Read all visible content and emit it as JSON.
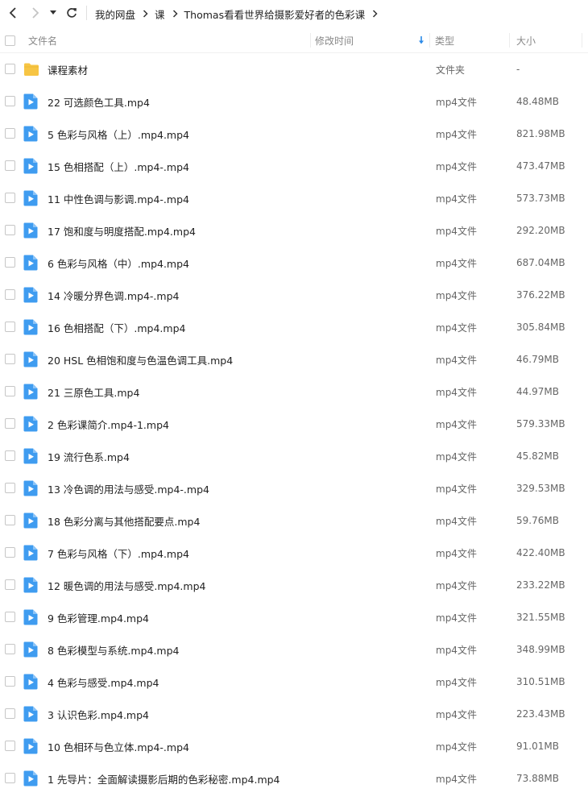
{
  "breadcrumb": [
    "我的网盘",
    "课",
    "Thomas看看世界给摄影爱好者的色彩课"
  ],
  "columns": {
    "name": "文件名",
    "modified": "修改时间",
    "type": "类型",
    "size": "大小"
  },
  "colors": {
    "accent": "#2b8ae8",
    "folder": "#f7c544",
    "video": "#3f9cf0"
  },
  "rows": [
    {
      "name": "课程素材",
      "type": "文件夹",
      "size": "-",
      "icon": "folder-icon"
    },
    {
      "name": "22 可选颜色工具.mp4",
      "type": "mp4文件",
      "size": "48.48MB",
      "icon": "video-file-icon"
    },
    {
      "name": "5 色彩与风格（上）.mp4.mp4",
      "type": "mp4文件",
      "size": "821.98MB",
      "icon": "video-file-icon"
    },
    {
      "name": "15 色相搭配（上）.mp4-.mp4",
      "type": "mp4文件",
      "size": "473.47MB",
      "icon": "video-file-icon"
    },
    {
      "name": "11 中性色调与影调.mp4-.mp4",
      "type": "mp4文件",
      "size": "573.73MB",
      "icon": "video-file-icon"
    },
    {
      "name": "17 饱和度与明度搭配.mp4.mp4",
      "type": "mp4文件",
      "size": "292.20MB",
      "icon": "video-file-icon"
    },
    {
      "name": "6 色彩与风格（中）.mp4.mp4",
      "type": "mp4文件",
      "size": "687.04MB",
      "icon": "video-file-icon"
    },
    {
      "name": "14 冷暖分界色调.mp4-.mp4",
      "type": "mp4文件",
      "size": "376.22MB",
      "icon": "video-file-icon"
    },
    {
      "name": "16 色相搭配（下）.mp4.mp4",
      "type": "mp4文件",
      "size": "305.84MB",
      "icon": "video-file-icon"
    },
    {
      "name": "20 HSL 色相饱和度与色温色调工具.mp4",
      "type": "mp4文件",
      "size": "46.79MB",
      "icon": "video-file-icon"
    },
    {
      "name": "21 三原色工具.mp4",
      "type": "mp4文件",
      "size": "44.97MB",
      "icon": "video-file-icon"
    },
    {
      "name": "2 色彩课简介.mp4-1.mp4",
      "type": "mp4文件",
      "size": "579.33MB",
      "icon": "video-file-icon"
    },
    {
      "name": "19 流行色系.mp4",
      "type": "mp4文件",
      "size": "45.82MB",
      "icon": "video-file-icon"
    },
    {
      "name": "13 冷色调的用法与感受.mp4-.mp4",
      "type": "mp4文件",
      "size": "329.53MB",
      "icon": "video-file-icon"
    },
    {
      "name": "18 色彩分离与其他搭配要点.mp4",
      "type": "mp4文件",
      "size": "59.76MB",
      "icon": "video-file-icon"
    },
    {
      "name": "7 色彩与风格（下）.mp4.mp4",
      "type": "mp4文件",
      "size": "422.40MB",
      "icon": "video-file-icon"
    },
    {
      "name": "12 暖色调的用法与感受.mp4.mp4",
      "type": "mp4文件",
      "size": "233.22MB",
      "icon": "video-file-icon"
    },
    {
      "name": "9 色彩管理.mp4.mp4",
      "type": "mp4文件",
      "size": "321.55MB",
      "icon": "video-file-icon"
    },
    {
      "name": "8 色彩模型与系统.mp4.mp4",
      "type": "mp4文件",
      "size": "348.99MB",
      "icon": "video-file-icon"
    },
    {
      "name": "4 色彩与感受.mp4.mp4",
      "type": "mp4文件",
      "size": "310.51MB",
      "icon": "video-file-icon"
    },
    {
      "name": "3 认识色彩.mp4.mp4",
      "type": "mp4文件",
      "size": "223.43MB",
      "icon": "video-file-icon"
    },
    {
      "name": "10 色相环与色立体.mp4-.mp4",
      "type": "mp4文件",
      "size": "91.01MB",
      "icon": "video-file-icon"
    },
    {
      "name": "1 先导片：全面解读摄影后期的色彩秘密.mp4.mp4",
      "type": "mp4文件",
      "size": "73.88MB",
      "icon": "video-file-icon"
    }
  ]
}
